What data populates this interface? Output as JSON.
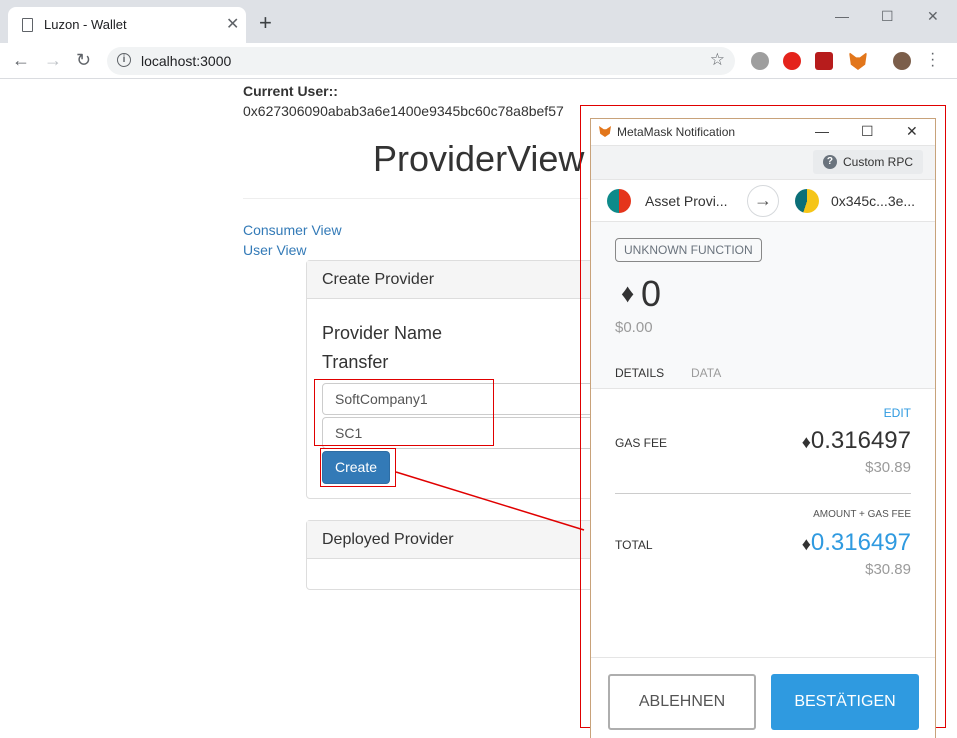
{
  "browser": {
    "tab_title": "Luzon - Wallet",
    "new_tab": "+",
    "url": "localhost:3000",
    "window_controls": [
      "—",
      "☐",
      "✕"
    ]
  },
  "page": {
    "current_user_label": "Current User::",
    "current_user_address": "0x627306090abab3a6e1400e9345bc60c78a8bef57",
    "heading": "ProviderView",
    "links": [
      "Consumer View",
      "User View"
    ],
    "create_panel": {
      "title": "Create Provider",
      "label_name": "Provider Name",
      "label_transfer": "Transfer",
      "input_name_value": "SoftCompany1",
      "input_transfer_value": "SC1",
      "button": "Create"
    },
    "deployed_panel": {
      "title": "Deployed Provider"
    }
  },
  "metamask": {
    "window_title": "MetaMask Notification",
    "network": "Custom RPC",
    "from_account": "Asset Provi...",
    "to_account": "0x345c...3e...",
    "function_badge": "UNKNOWN FUNCTION",
    "amount_eth": "0",
    "amount_usd": "$0.00",
    "tabs": [
      "DETAILS",
      "DATA"
    ],
    "active_tab": "DETAILS",
    "edit_label": "EDIT",
    "gas_fee_label": "GAS FEE",
    "gas_fee_eth": "0.316497",
    "gas_fee_usd": "$30.89",
    "total_caption": "AMOUNT + GAS FEE",
    "total_label": "TOTAL",
    "total_eth": "0.316497",
    "total_usd": "$30.89",
    "reject_button": "ABLEHNEN",
    "confirm_button": "BESTÄTIGEN"
  },
  "colors": {
    "link": "#337ab7",
    "button_primary": "#337ab7",
    "metamask_blue": "#2f9ae0",
    "highlight_red": "#e00000"
  }
}
